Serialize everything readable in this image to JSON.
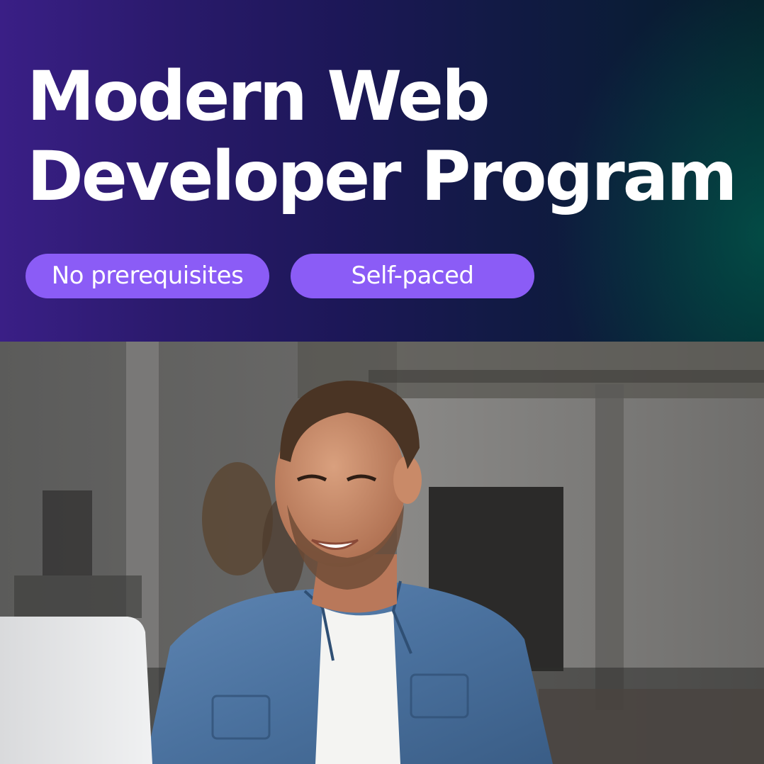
{
  "banner": {
    "title_line1": "Modern Web",
    "title_line2": "Developer Program",
    "chips": [
      {
        "label": "No prerequisites"
      },
      {
        "label": "Self-paced"
      }
    ]
  },
  "photo": {
    "subject": "smiling man in denim shirt working on a laptop"
  },
  "colors": {
    "chip_bg": "#8b5cf6",
    "title_text": "#ffffff",
    "banner_start": "#3a1f86",
    "banner_end": "#06202b"
  }
}
